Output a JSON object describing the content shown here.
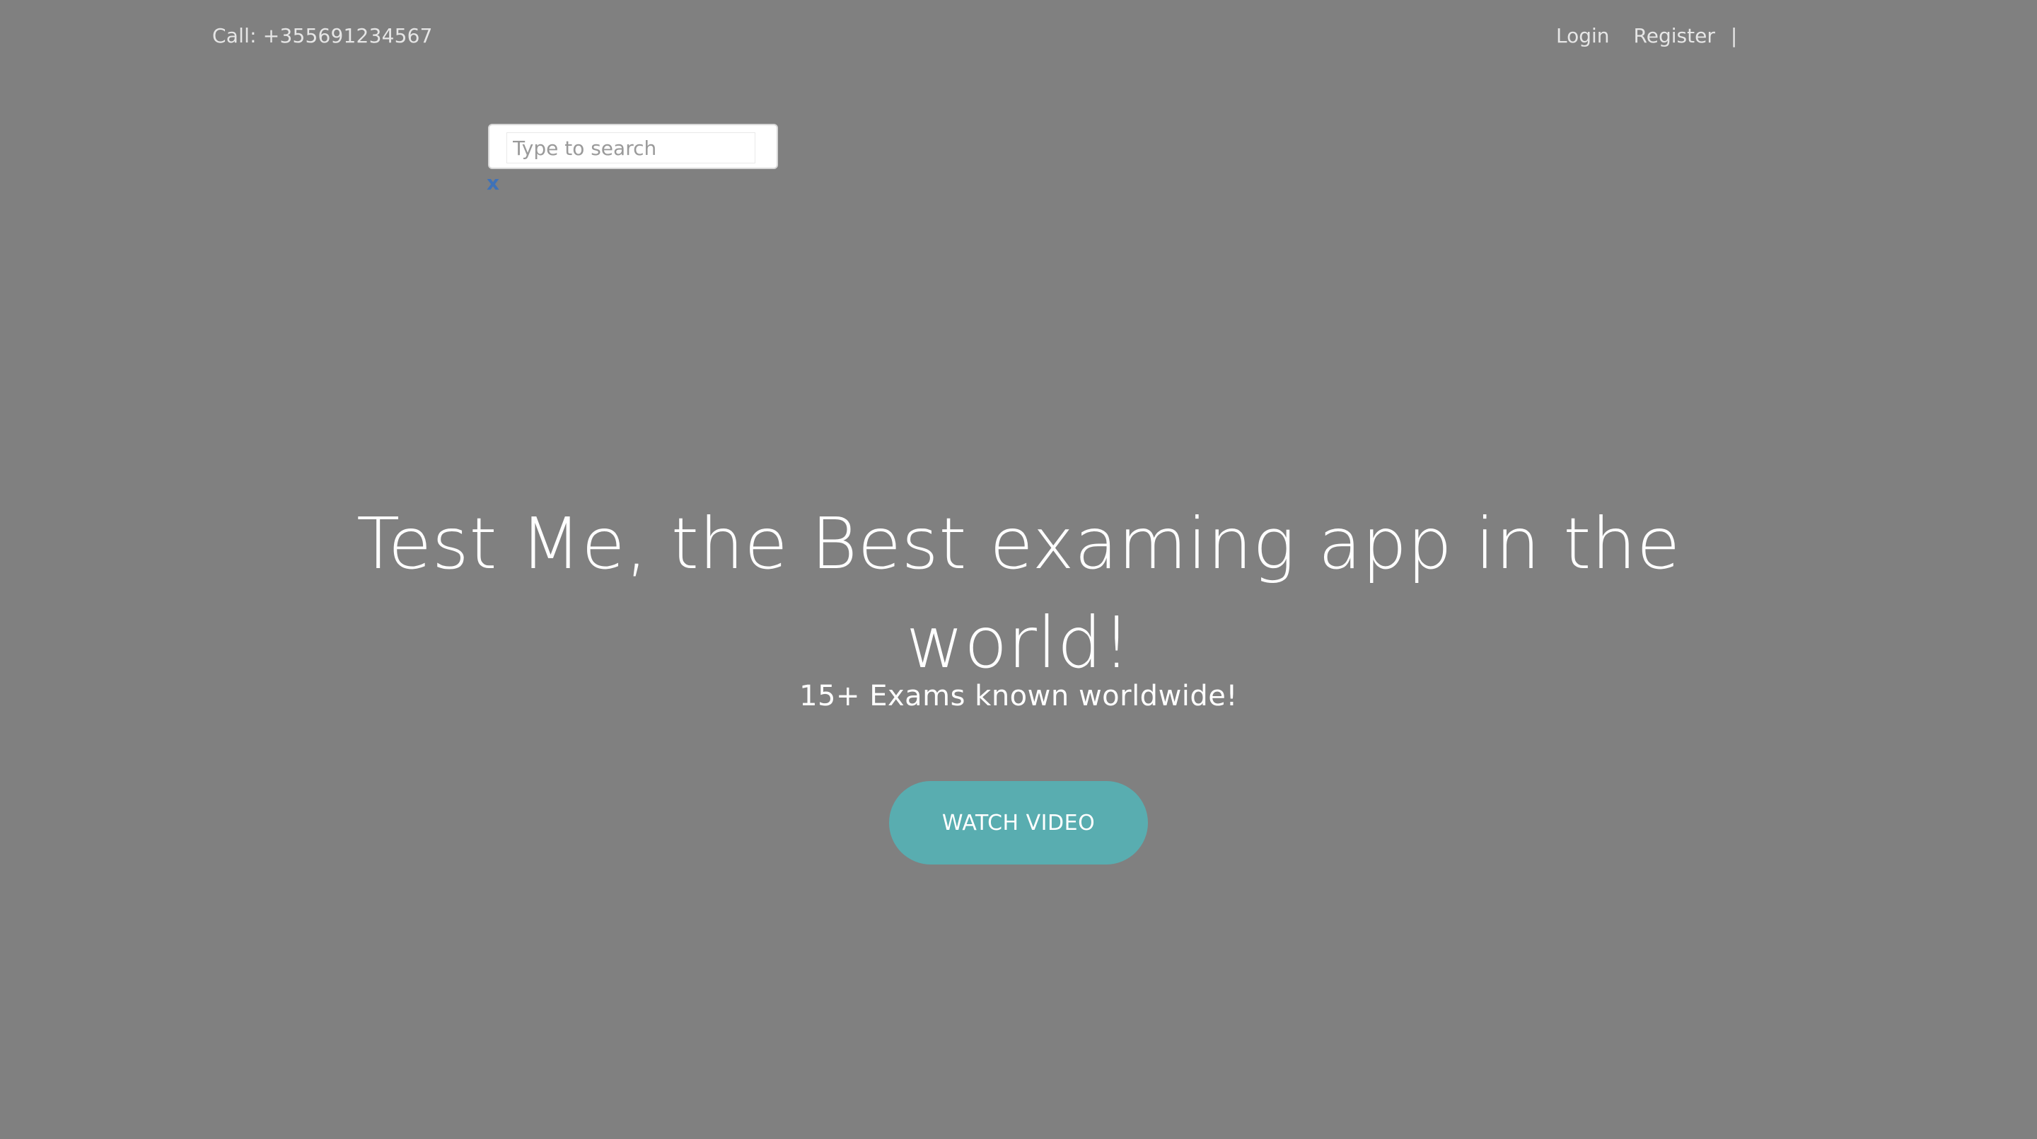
{
  "topbar": {
    "phone": "Call: +355691234567",
    "login_label": "Login",
    "register_label": "Register",
    "separator": "|"
  },
  "search": {
    "placeholder": "Type to search",
    "value": "",
    "close_label": "x"
  },
  "hero": {
    "title": "Test Me, the Best examing app in the world!",
    "subtitle": "15+ Exams known worldwide!",
    "cta_label": "WATCH VIDEO"
  },
  "colors": {
    "background": "#808080",
    "cta_background": "#59adb0",
    "close_icon": "#3f72b8",
    "text": "#ffffff"
  }
}
